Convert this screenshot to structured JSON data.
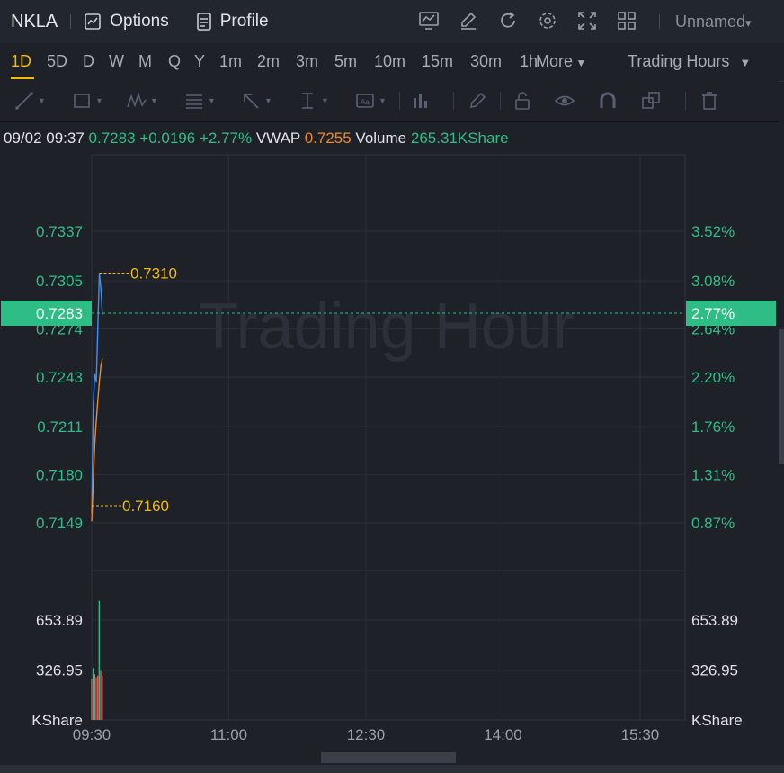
{
  "app": {
    "symbol": "NKLA",
    "options_label": "Options",
    "profile_label": "Profile",
    "layout_name": "Unnamed",
    "icons": [
      "indicator-icon",
      "draw-icon",
      "refresh-icon",
      "settings-icon",
      "fullscreen-icon",
      "layout-grid-icon"
    ]
  },
  "timeframes": [
    "1D",
    "5D",
    "D",
    "W",
    "M",
    "Q",
    "Y",
    "1m",
    "2m",
    "3m",
    "5m",
    "10m",
    "15m",
    "30m",
    "1h"
  ],
  "timeframe_active": "1D",
  "more_label": "More",
  "session_label": "Trading Hours",
  "drawing_tools": [
    "line-tool-icon",
    "rectangle-tool-icon",
    "pattern-tool-icon",
    "fib-tool-icon",
    "arrow-tool-icon",
    "measure-tool-icon",
    "text-tool-icon",
    "chart-type-icon",
    "pencil-icon",
    "lock-icon",
    "eye-icon",
    "magnet-icon",
    "clone-icon",
    "trash-icon"
  ],
  "info": {
    "datetime": "09/02 09:37",
    "price": "0.7283",
    "change": "+0.0196",
    "change_pct": "+2.77%",
    "vwap_label": "VWAP",
    "vwap": "0.7255",
    "volume_label": "Volume",
    "volume": "265.31KShare"
  },
  "colors": {
    "up": "#2ebd85",
    "down": "#e8504f",
    "price_line": "#3b8ff5",
    "vwap_line": "#f08a24",
    "marker": "#f0b90b"
  },
  "chart_data": {
    "type": "line",
    "watermark": "Trading Hour",
    "price_axis": {
      "ticks": [
        "0.7337",
        "0.7305",
        "0.7274",
        "0.7243",
        "0.7211",
        "0.7180",
        "0.7149"
      ],
      "tick_values": [
        0.7337,
        0.7305,
        0.7274,
        0.7243,
        0.7211,
        0.718,
        0.7149
      ],
      "pct_ticks": [
        "3.52%",
        "3.08%",
        "2.64%",
        "2.20%",
        "1.76%",
        "1.31%",
        "0.87%"
      ],
      "current_price": "0.7283",
      "current_pct": "2.77%"
    },
    "volume_axis": {
      "ticks": [
        "653.89",
        "326.95"
      ],
      "tick_values": [
        653.89,
        326.95
      ],
      "unit": "KShare"
    },
    "time_axis": [
      "09:30",
      "11:00",
      "12:30",
      "14:00",
      "15:30"
    ],
    "high_label": "0.7310",
    "low_label": "0.7160",
    "series": [
      {
        "name": "",
        "role": "price",
        "x_minutes": [
          0,
          1,
          2,
          3,
          4,
          5,
          6,
          7
        ],
        "values": [
          0.7155,
          0.7225,
          0.7245,
          0.724,
          0.7275,
          0.731,
          0.73,
          0.7283
        ]
      },
      {
        "name": "",
        "role": "vwap",
        "x_minutes": [
          0,
          1,
          2,
          3,
          4,
          5,
          6,
          7
        ],
        "values": [
          0.715,
          0.7175,
          0.72,
          0.7215,
          0.7228,
          0.724,
          0.725,
          0.7255
        ]
      }
    ],
    "volume_bars": [
      {
        "x_minute": 0,
        "value": 270,
        "dir": "down"
      },
      {
        "x_minute": 1,
        "value": 340,
        "dir": "up"
      },
      {
        "x_minute": 2,
        "value": 300,
        "dir": "up"
      },
      {
        "x_minute": 3,
        "value": 280,
        "dir": "down"
      },
      {
        "x_minute": 4,
        "value": 290,
        "dir": "down"
      },
      {
        "x_minute": 5,
        "value": 780,
        "dir": "up"
      },
      {
        "x_minute": 6,
        "value": 320,
        "dir": "down"
      },
      {
        "x_minute": 7,
        "value": 290,
        "dir": "down"
      }
    ]
  }
}
